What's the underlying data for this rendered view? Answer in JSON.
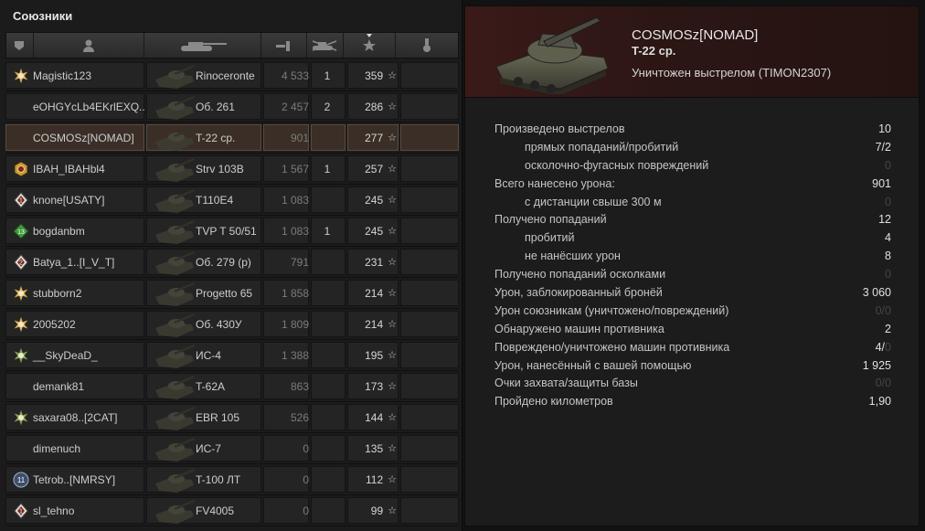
{
  "left_panel": {
    "title": "Союзники",
    "header_icons": [
      "platoon-icon",
      "player-icon",
      "tank-icon",
      "damage-icon",
      "kills-icon",
      "xp-star-icon",
      "medal-icon"
    ]
  },
  "players": [
    {
      "name": "Magistic123",
      "badge": "star-gold",
      "tank": "Rinoceronte",
      "damage": "4 533",
      "kills": "1",
      "xp": "359",
      "selected": false
    },
    {
      "name": "eOHGYcLb4EKrlEXQ..",
      "badge": "",
      "tank": "Об. 261",
      "damage": "2 457",
      "kills": "2",
      "xp": "286",
      "selected": false
    },
    {
      "name": "COSMOSz[NOMAD]",
      "badge": "",
      "tank": "T-22 ср.",
      "damage": "901",
      "kills": "",
      "xp": "277",
      "selected": true
    },
    {
      "name": "IBAH_IBAHbl4",
      "badge": "hex-gold",
      "tank": "Strv 103B",
      "damage": "1 567",
      "kills": "1",
      "xp": "257",
      "selected": false
    },
    {
      "name": "knone[USATY]",
      "badge": "diamond-1",
      "tank": "T110E4",
      "damage": "1 083",
      "kills": "",
      "xp": "245",
      "selected": false
    },
    {
      "name": "bogdanbm",
      "badge": "green-13",
      "tank": "TVP T 50/51",
      "damage": "1 083",
      "kills": "1",
      "xp": "245",
      "selected": false
    },
    {
      "name": "Batya_1..[I_V_T]",
      "badge": "diamond-2",
      "tank": "Об. 279 (р)",
      "damage": "791",
      "kills": "",
      "xp": "231",
      "selected": false
    },
    {
      "name": "stubborn2",
      "badge": "star-gold",
      "tank": "Progetto 65",
      "damage": "1 858",
      "kills": "",
      "xp": "214",
      "selected": false
    },
    {
      "name": "2005202",
      "badge": "star-gold",
      "tank": "Об. 430У",
      "damage": "1 809",
      "kills": "",
      "xp": "214",
      "selected": false
    },
    {
      "name": "__SkyDeaD_",
      "badge": "star-green",
      "tank": "ИС-4",
      "damage": "1 388",
      "kills": "",
      "xp": "195",
      "selected": false
    },
    {
      "name": "demank81",
      "badge": "",
      "tank": "T-62A",
      "damage": "863",
      "kills": "",
      "xp": "173",
      "selected": false
    },
    {
      "name": "saxara08..[2CAT]",
      "badge": "star-green",
      "tank": "EBR 105",
      "damage": "526",
      "kills": "",
      "xp": "144",
      "selected": false
    },
    {
      "name": "dimenuch",
      "badge": "",
      "tank": "ИС-7",
      "damage": "0",
      "kills": "",
      "xp": "135",
      "selected": false
    },
    {
      "name": "Tetrob..[NMRSY]",
      "badge": "circle-11",
      "tank": "T-100 ЛТ",
      "damage": "0",
      "kills": "",
      "xp": "112",
      "selected": false
    },
    {
      "name": "sl_tehno",
      "badge": "diamond-1",
      "tank": "FV4005",
      "damage": "0",
      "kills": "",
      "xp": "99",
      "selected": false
    }
  ],
  "detail": {
    "player": "COSMOSz[NOMAD]",
    "vehicle": "T-22 ср.",
    "death_text": "Уничтожен выстрелом (TIMON2307)",
    "stats": [
      {
        "label": "Произведено выстрелов",
        "value": "10",
        "sub": false,
        "dim": false
      },
      {
        "label": "прямых попаданий/пробитий",
        "value": "7/2",
        "sub": true,
        "dim": false
      },
      {
        "label": "осколочно-фугасных повреждений",
        "value": "0",
        "sub": true,
        "dim": true
      },
      {
        "label": "Всего нанесено урона:",
        "value": "901",
        "sub": false,
        "dim": false
      },
      {
        "label": "с дистанции свыше 300 м",
        "value": "0",
        "sub": true,
        "dim": true
      },
      {
        "label": "Получено попаданий",
        "value": "12",
        "sub": false,
        "dim": false
      },
      {
        "label": "пробитий",
        "value": "4",
        "sub": true,
        "dim": false
      },
      {
        "label": "не нанёсших урон",
        "value": "8",
        "sub": true,
        "dim": false
      },
      {
        "label": "Получено попаданий осколками",
        "value": "0",
        "sub": false,
        "dim": true
      },
      {
        "label": "Урон, заблокированный бронёй",
        "value": "3 060",
        "sub": false,
        "dim": false
      },
      {
        "label": "Урон союзникам (уничтожено/повреждений)",
        "value": "0/0",
        "sub": false,
        "dim": true
      },
      {
        "label": "Обнаружено машин противника",
        "value": "2",
        "sub": false,
        "dim": false
      },
      {
        "label": "Повреждено/уничтожено машин противника",
        "value": "4/",
        "value_dim": "0",
        "sub": false,
        "dim": false
      },
      {
        "label": "Урон, нанесённый с вашей помощью",
        "value": "1 925",
        "sub": false,
        "dim": false
      },
      {
        "label": "Очки захвата/защиты базы",
        "value": "0/0",
        "sub": false,
        "dim": true
      },
      {
        "label": "Пройдено километров",
        "value": "1,90",
        "sub": false,
        "dim": false
      }
    ]
  }
}
